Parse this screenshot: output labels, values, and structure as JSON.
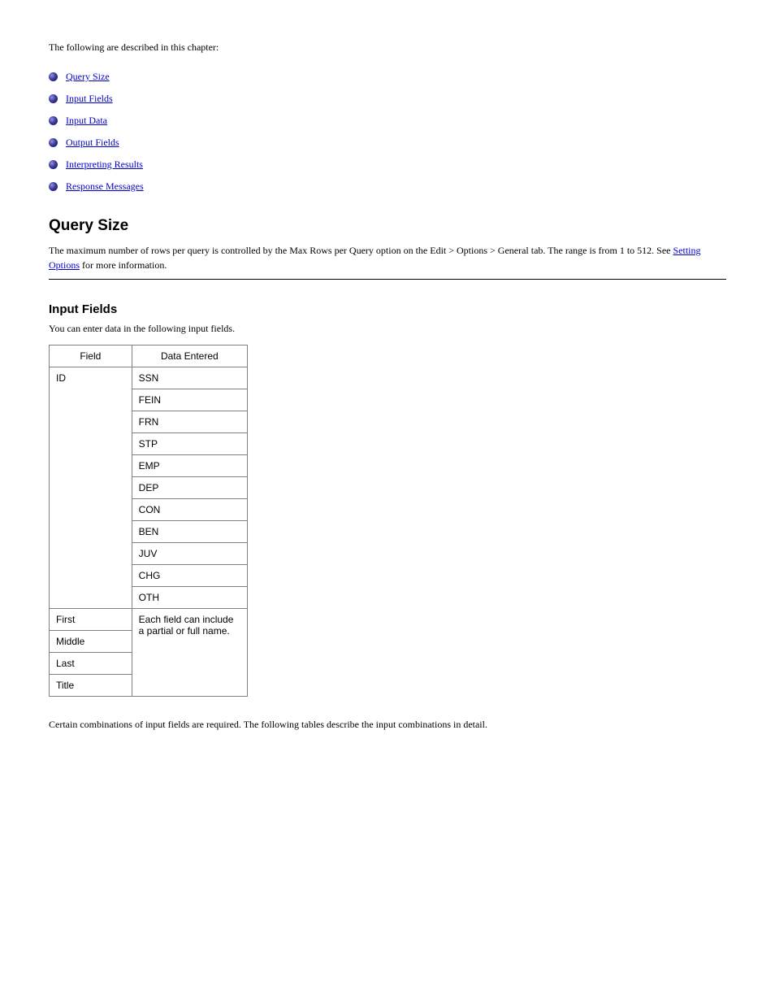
{
  "intro": "The following are described in this chapter:",
  "bullets": [
    {
      "label": "Query Size"
    },
    {
      "label": "Input Fields"
    },
    {
      "label": "Input Data"
    },
    {
      "label": "Output Fields"
    },
    {
      "label": "Interpreting Results"
    },
    {
      "label": "Response Messages"
    }
  ],
  "section1": {
    "heading": "Query Size",
    "body_before": "The maximum number of rows per query is controlled by the Max Rows per Query option on the Edit > Options > General tab. The range is from 1 to 512. See ",
    "body_link": "Setting Options",
    "body_after": " for more information."
  },
  "section2": {
    "heading": "Input Fields",
    "body": "You can enter data in the following input fields."
  },
  "table": {
    "header": [
      "Field",
      "Data Entered"
    ],
    "group1": {
      "label": "ID",
      "values": [
        "SSN",
        "FEIN",
        "FRN",
        "STP",
        "EMP",
        "DEP",
        "CON",
        "BEN",
        "JUV",
        "CHG",
        "OTH"
      ]
    },
    "rows": [
      {
        "label": "First",
        "rowspan_value": "Each field can include a partial or full name."
      },
      {
        "label": "Middle"
      },
      {
        "label": "Last"
      },
      {
        "label": "Title"
      }
    ]
  },
  "note": "Certain combinations of input fields are required. The following tables describe the input combinations in detail."
}
